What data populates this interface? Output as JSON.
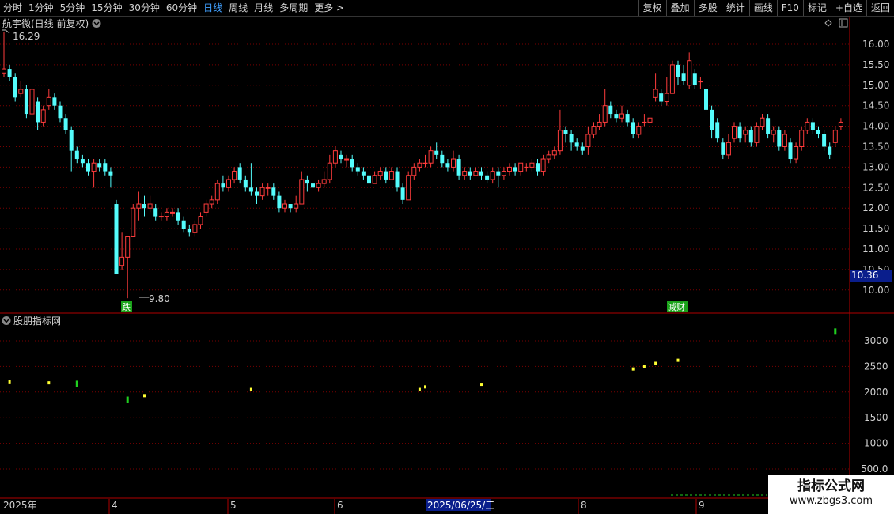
{
  "toolbar": {
    "periods": [
      "分时",
      "1分钟",
      "5分钟",
      "15分钟",
      "30分钟",
      "60分钟",
      "日线",
      "周线",
      "月线",
      "多周期",
      "更多"
    ],
    "active_period": "日线",
    "more_arrow": ">",
    "actions": [
      "复权",
      "叠加",
      "多股",
      "统计",
      "画线",
      "F10",
      "标记",
      "+自选",
      "返回"
    ]
  },
  "main_panel": {
    "title": "航宇微(日线 前复权)",
    "current_price": "10.36",
    "price_ticks": [
      "16.00",
      "15.50",
      "15.00",
      "14.50",
      "14.00",
      "13.50",
      "13.00",
      "12.50",
      "12.00",
      "11.50",
      "11.00",
      "10.50",
      "10.00"
    ],
    "high_label": "16.29",
    "low_label": "9.80",
    "markers": [
      {
        "label": "跌",
        "color": "#1aa31a"
      },
      {
        "label": "减财",
        "color": "#1aa31a"
      }
    ]
  },
  "sub_panel": {
    "title": "股朋指标网",
    "ticks": [
      "3000",
      "2500",
      "2000",
      "1500",
      "1000",
      "500.0"
    ]
  },
  "date_axis": {
    "labels": [
      "2025年",
      "4",
      "5",
      "6",
      "8",
      "9"
    ],
    "highlight": "2025/06/25/三"
  },
  "watermark": {
    "title": "指标公式网",
    "url": "www.zbgs3.com"
  },
  "colors": {
    "up": "#ff3c3c",
    "down": "#54fcfc",
    "grid": "#7a0000",
    "axis": "#b00000",
    "yellow": "#ffff33",
    "green": "#20d020"
  },
  "chart_data": {
    "type": "candlestick",
    "price_range": [
      9.6,
      16.5
    ],
    "indicator_range": [
      0,
      3500
    ],
    "candles": [
      [
        15.3,
        15.4,
        16.29,
        15.2
      ],
      [
        15.4,
        15.2,
        15.5,
        15.1
      ],
      [
        15.2,
        14.7,
        15.3,
        14.6
      ],
      [
        14.8,
        14.9,
        15.1,
        14.7
      ],
      [
        14.9,
        14.3,
        15.0,
        14.2
      ],
      [
        14.3,
        14.9,
        15.0,
        14.2
      ],
      [
        14.6,
        14.1,
        14.7,
        13.9
      ],
      [
        14.1,
        14.4,
        14.5,
        14.0
      ],
      [
        14.5,
        14.7,
        14.9,
        14.4
      ],
      [
        14.7,
        14.5,
        14.8,
        14.4
      ],
      [
        14.5,
        14.2,
        14.6,
        14.1
      ],
      [
        14.2,
        13.9,
        14.3,
        13.8
      ],
      [
        13.9,
        13.4,
        14.0,
        12.9
      ],
      [
        13.4,
        13.2,
        13.5,
        13.1
      ],
      [
        13.2,
        13.1,
        13.3,
        13.0
      ],
      [
        13.1,
        12.9,
        13.2,
        12.8
      ],
      [
        12.9,
        13.1,
        13.2,
        12.5
      ],
      [
        13.1,
        13.0,
        13.2,
        12.9
      ],
      [
        13.1,
        12.9,
        13.2,
        12.8
      ],
      [
        12.9,
        12.8,
        13.0,
        12.5
      ],
      [
        12.1,
        10.4,
        12.2,
        10.4
      ],
      [
        10.6,
        10.8,
        11.4,
        10.5
      ],
      [
        10.8,
        11.3,
        11.3,
        9.8
      ],
      [
        11.3,
        12.0,
        12.1,
        11.3
      ],
      [
        12.0,
        12.1,
        12.4,
        11.7
      ],
      [
        12.1,
        12.0,
        12.3,
        11.8
      ],
      [
        12.0,
        12.1,
        12.3,
        11.9
      ],
      [
        12.0,
        11.8,
        12.1,
        11.7
      ],
      [
        11.8,
        11.8,
        11.9,
        11.7
      ],
      [
        11.8,
        11.9,
        12.0,
        11.7
      ],
      [
        11.9,
        11.9,
        12.0,
        11.8
      ],
      [
        11.9,
        11.7,
        12.0,
        11.6
      ],
      [
        11.7,
        11.5,
        11.8,
        11.4
      ],
      [
        11.5,
        11.4,
        11.6,
        11.3
      ],
      [
        11.4,
        11.6,
        11.7,
        11.3
      ],
      [
        11.6,
        11.8,
        11.9,
        11.5
      ],
      [
        11.9,
        12.1,
        12.2,
        11.8
      ],
      [
        12.1,
        12.2,
        12.3,
        12.0
      ],
      [
        12.2,
        12.6,
        12.7,
        12.1
      ],
      [
        12.6,
        12.5,
        12.8,
        12.4
      ],
      [
        12.5,
        12.7,
        12.8,
        12.4
      ],
      [
        12.7,
        12.9,
        13.0,
        12.6
      ],
      [
        13.0,
        12.7,
        13.1,
        12.6
      ],
      [
        12.7,
        12.5,
        12.8,
        12.4
      ],
      [
        12.5,
        12.4,
        13.1,
        12.3
      ],
      [
        12.4,
        12.3,
        12.5,
        12.1
      ],
      [
        12.3,
        12.5,
        12.6,
        12.2
      ],
      [
        12.5,
        12.5,
        12.6,
        12.3
      ],
      [
        12.5,
        12.3,
        12.6,
        12.2
      ],
      [
        12.3,
        12.0,
        12.4,
        11.9
      ],
      [
        12.0,
        12.1,
        12.2,
        11.9
      ],
      [
        12.1,
        12.0,
        12.1,
        11.9
      ],
      [
        12.0,
        12.1,
        12.3,
        11.9
      ],
      [
        12.1,
        12.7,
        12.9,
        12.1
      ],
      [
        12.7,
        12.6,
        12.8,
        12.4
      ],
      [
        12.6,
        12.5,
        12.7,
        12.4
      ],
      [
        12.5,
        12.6,
        12.7,
        12.4
      ],
      [
        12.6,
        12.7,
        12.9,
        12.5
      ],
      [
        12.7,
        13.1,
        13.3,
        12.6
      ],
      [
        13.1,
        13.4,
        13.5,
        13.0
      ],
      [
        13.3,
        13.2,
        13.4,
        13.1
      ],
      [
        13.2,
        13.2,
        13.3,
        13.0
      ],
      [
        13.2,
        13.0,
        13.3,
        12.9
      ],
      [
        13.0,
        12.9,
        13.1,
        12.8
      ],
      [
        12.9,
        12.8,
        13.0,
        12.7
      ],
      [
        12.8,
        12.6,
        12.9,
        12.5
      ],
      [
        12.6,
        12.8,
        12.9,
        12.6
      ],
      [
        12.8,
        12.9,
        13.0,
        12.7
      ],
      [
        12.9,
        12.7,
        13.0,
        12.6
      ],
      [
        12.7,
        12.9,
        13.0,
        12.7
      ],
      [
        12.9,
        12.5,
        13.0,
        12.4
      ],
      [
        12.5,
        12.2,
        12.6,
        12.1
      ],
      [
        12.2,
        12.8,
        12.9,
        12.2
      ],
      [
        12.8,
        13.0,
        13.1,
        12.7
      ],
      [
        13.0,
        13.1,
        13.2,
        12.9
      ],
      [
        13.1,
        13.1,
        13.3,
        13.0
      ],
      [
        13.1,
        13.4,
        13.5,
        13.0
      ],
      [
        13.4,
        13.3,
        13.6,
        13.2
      ],
      [
        13.3,
        13.1,
        13.4,
        13.0
      ],
      [
        13.1,
        13.0,
        13.2,
        12.9
      ],
      [
        13.0,
        13.2,
        13.4,
        12.9
      ],
      [
        13.2,
        12.8,
        13.3,
        12.7
      ],
      [
        12.8,
        12.9,
        13.0,
        12.7
      ],
      [
        12.9,
        12.8,
        13.0,
        12.7
      ],
      [
        12.8,
        12.9,
        13.0,
        12.8
      ],
      [
        12.9,
        12.8,
        13.0,
        12.7
      ],
      [
        12.8,
        12.7,
        12.9,
        12.6
      ],
      [
        12.7,
        12.9,
        13.0,
        12.6
      ],
      [
        12.9,
        12.8,
        13.0,
        12.5
      ],
      [
        12.8,
        12.9,
        13.0,
        12.7
      ],
      [
        12.9,
        13.0,
        13.1,
        12.8
      ],
      [
        13.0,
        12.9,
        13.1,
        12.8
      ],
      [
        12.9,
        13.1,
        13.1,
        12.8
      ],
      [
        13.0,
        13.0,
        13.1,
        12.9
      ],
      [
        13.0,
        13.1,
        13.2,
        12.9
      ],
      [
        13.1,
        12.9,
        13.2,
        12.8
      ],
      [
        12.9,
        13.2,
        13.3,
        12.8
      ],
      [
        13.2,
        13.3,
        13.4,
        13.1
      ],
      [
        13.3,
        13.4,
        13.5,
        13.2
      ],
      [
        13.4,
        13.9,
        14.4,
        13.3
      ],
      [
        13.9,
        13.8,
        14.0,
        13.6
      ],
      [
        13.8,
        13.6,
        13.9,
        13.4
      ],
      [
        13.6,
        13.5,
        13.7,
        13.4
      ],
      [
        13.5,
        13.4,
        13.6,
        13.3
      ],
      [
        13.5,
        13.8,
        14.0,
        13.3
      ],
      [
        13.8,
        14.0,
        14.1,
        13.7
      ],
      [
        14.0,
        14.1,
        14.3,
        13.9
      ],
      [
        14.1,
        14.5,
        14.9,
        14.0
      ],
      [
        14.5,
        14.3,
        14.6,
        14.2
      ],
      [
        14.3,
        14.2,
        14.4,
        14.1
      ],
      [
        14.2,
        14.3,
        14.5,
        14.1
      ],
      [
        14.3,
        14.1,
        14.4,
        14.0
      ],
      [
        14.1,
        13.8,
        14.2,
        13.7
      ],
      [
        13.8,
        14.0,
        14.1,
        13.7
      ],
      [
        14.1,
        14.1,
        14.3,
        14.0
      ],
      [
        14.1,
        14.2,
        14.3,
        14.0
      ],
      [
        14.7,
        14.9,
        15.3,
        14.6
      ],
      [
        14.8,
        14.6,
        14.9,
        14.5
      ],
      [
        14.6,
        14.8,
        15.2,
        14.5
      ],
      [
        14.8,
        15.5,
        15.6,
        14.8
      ],
      [
        15.5,
        15.2,
        15.6,
        15.0
      ],
      [
        15.3,
        15.1,
        15.5,
        15.0
      ],
      [
        15.0,
        15.6,
        15.8,
        14.9
      ],
      [
        15.3,
        15.0,
        15.4,
        14.9
      ],
      [
        15.1,
        15.1,
        15.2,
        14.9
      ],
      [
        14.9,
        14.4,
        15.0,
        14.3
      ],
      [
        14.4,
        13.9,
        14.5,
        13.7
      ],
      [
        14.1,
        13.7,
        14.2,
        13.6
      ],
      [
        13.6,
        13.3,
        13.7,
        13.2
      ],
      [
        13.3,
        13.6,
        13.8,
        13.2
      ],
      [
        13.7,
        14.0,
        14.1,
        13.6
      ],
      [
        14.0,
        13.7,
        14.1,
        13.6
      ],
      [
        13.8,
        13.9,
        14.0,
        13.6
      ],
      [
        13.9,
        13.6,
        14.0,
        13.5
      ],
      [
        13.6,
        14.0,
        14.1,
        13.5
      ],
      [
        14.0,
        14.2,
        14.3,
        13.9
      ],
      [
        14.2,
        13.8,
        14.3,
        13.7
      ],
      [
        13.8,
        13.9,
        14.0,
        13.6
      ],
      [
        13.9,
        13.5,
        14.0,
        13.4
      ],
      [
        13.5,
        13.8,
        13.9,
        13.4
      ],
      [
        13.6,
        13.2,
        13.7,
        13.1
      ],
      [
        13.2,
        13.5,
        13.6,
        13.1
      ],
      [
        13.5,
        13.9,
        14.0,
        13.4
      ],
      [
        13.9,
        14.1,
        14.2,
        13.8
      ],
      [
        14.1,
        13.9,
        14.2,
        13.8
      ],
      [
        13.9,
        13.8,
        14.0,
        13.7
      ],
      [
        13.8,
        13.5,
        13.9,
        13.4
      ],
      [
        13.5,
        13.3,
        13.6,
        13.2
      ],
      [
        13.6,
        13.9,
        14.0,
        13.5
      ],
      [
        14.0,
        14.1,
        14.2,
        13.9
      ],
      [
        14.1,
        13.9,
        14.2,
        13.8
      ],
      [
        13.9,
        13.5,
        14.0,
        13.4
      ]
    ],
    "indicator_points": [
      {
        "i": 1,
        "v": 2200,
        "c": "yellow"
      },
      {
        "i": 8,
        "v": 2180,
        "c": "yellow"
      },
      {
        "i": 13,
        "v": 2160,
        "c": "green"
      },
      {
        "i": 22,
        "v": 1850,
        "c": "green"
      },
      {
        "i": 25,
        "v": 1930,
        "c": "yellow"
      },
      {
        "i": 44,
        "v": 2050,
        "c": "yellow"
      },
      {
        "i": 74,
        "v": 2050,
        "c": "yellow"
      },
      {
        "i": 75,
        "v": 2100,
        "c": "yellow"
      },
      {
        "i": 85,
        "v": 2150,
        "c": "yellow"
      },
      {
        "i": 112,
        "v": 2450,
        "c": "yellow"
      },
      {
        "i": 114,
        "v": 2500,
        "c": "yellow"
      },
      {
        "i": 116,
        "v": 2560,
        "c": "yellow"
      },
      {
        "i": 120,
        "v": 2620,
        "c": "yellow"
      },
      {
        "i": 148,
        "v": 3180,
        "c": "green"
      }
    ]
  }
}
